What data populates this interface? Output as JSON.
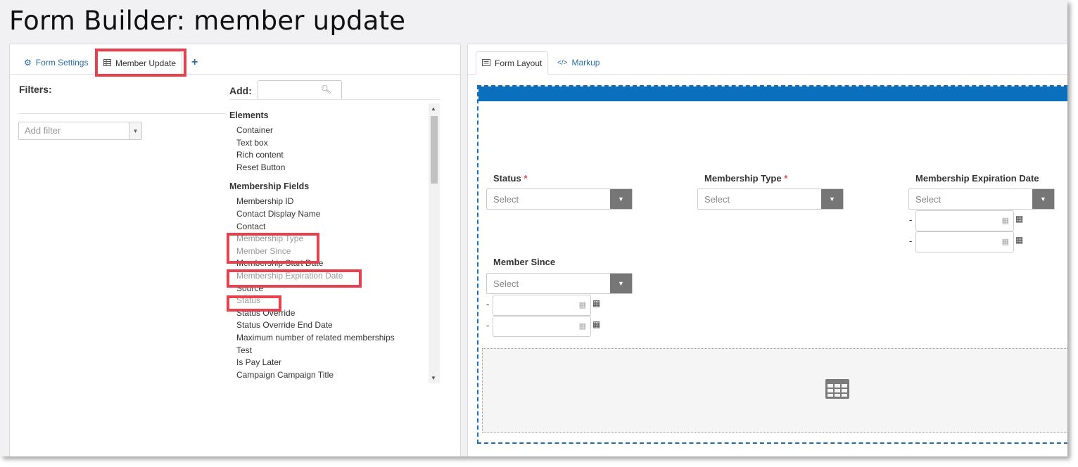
{
  "page": {
    "title": "Form Builder: member update"
  },
  "left_tabs": [
    {
      "label": "Form Settings",
      "icon": "gear-icon"
    },
    {
      "label": "Member Update",
      "icon": "table-icon"
    }
  ],
  "add_tab_symbol": "+",
  "filters": {
    "label": "Filters:",
    "add_filter_placeholder": "Add filter"
  },
  "palette": {
    "add_label": "Add:",
    "search_value": "",
    "groups": [
      {
        "title": "Elements",
        "items": [
          "Container",
          "Text box",
          "Rich content",
          "Reset Button"
        ]
      },
      {
        "title": "Membership Fields",
        "items": [
          "Membership ID",
          "Contact Display Name",
          "Contact",
          "Membership Type",
          "Member Since",
          "Membership Start Date",
          "Membership Expiration Date",
          "Source",
          "Status",
          "Status Override",
          "Status Override End Date",
          "Maximum number of related memberships",
          "Test",
          "Is Pay Later",
          "Campaign Campaign Title"
        ]
      }
    ],
    "used_items": [
      "Membership Type",
      "Member Since",
      "Membership Expiration Date",
      "Status"
    ]
  },
  "right_tabs": [
    {
      "label": "Form Layout",
      "icon": "layout-icon"
    },
    {
      "label": "Markup",
      "icon": "code-icon"
    }
  ],
  "form_fields": [
    {
      "label": "Status",
      "required": "*",
      "placeholder": "Select",
      "date_range": false
    },
    {
      "label": "Membership Type",
      "required": "*",
      "placeholder": "Select",
      "date_range": false
    },
    {
      "label": "Membership Expiration Date",
      "required": "",
      "placeholder": "Select",
      "date_range": true
    },
    {
      "label": "Member Since",
      "required": "",
      "placeholder": "Select",
      "date_range": true
    }
  ],
  "date_range_separator": "-",
  "colors": {
    "accent": "#0a6fbd",
    "highlight": "#e8414e",
    "link": "#2c6fa8",
    "select_button": "#767676"
  }
}
